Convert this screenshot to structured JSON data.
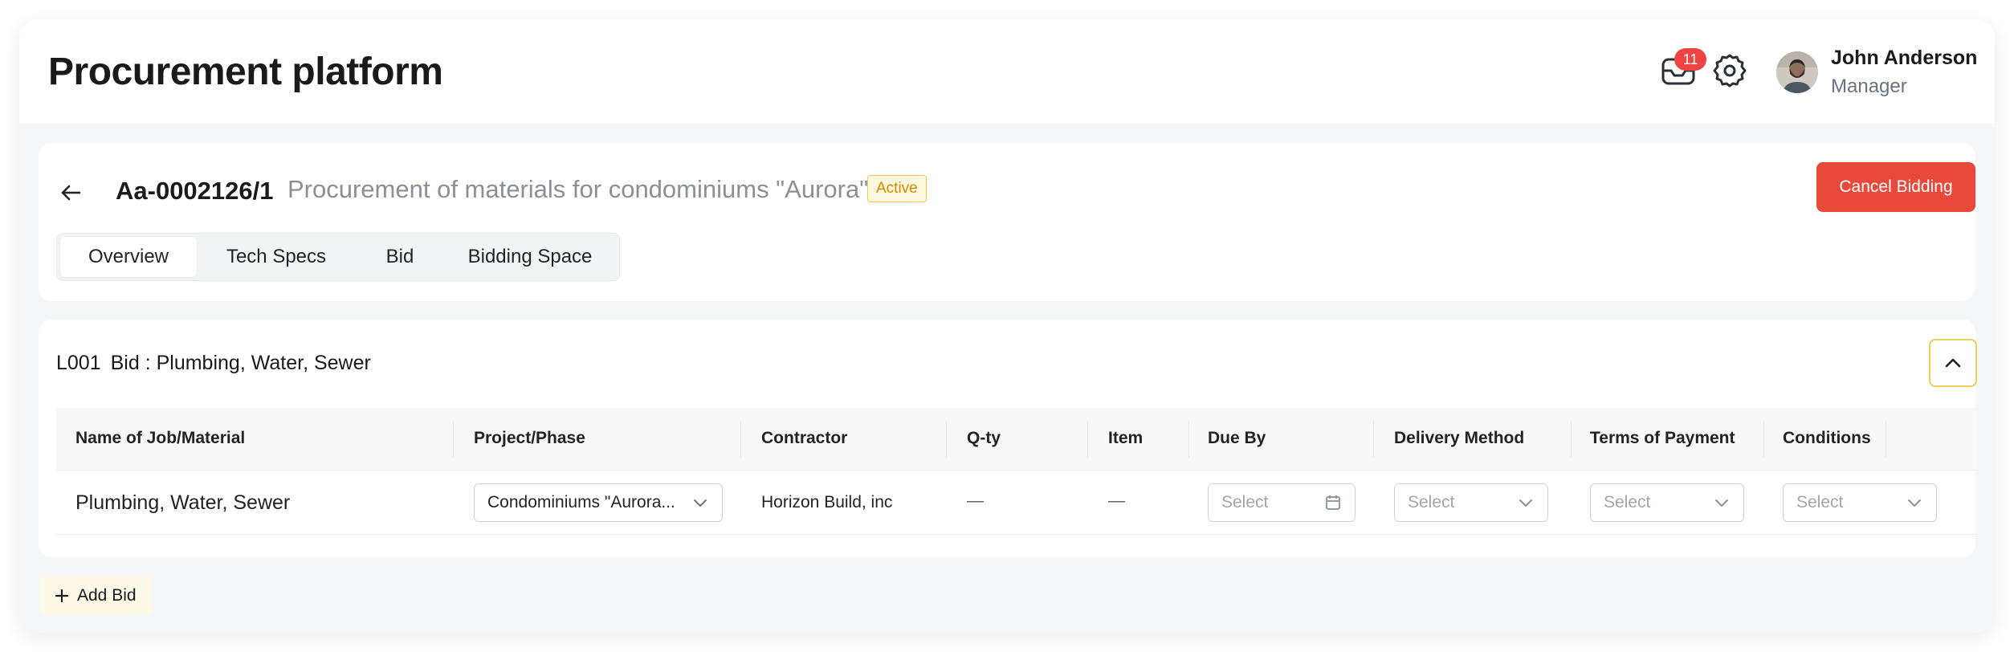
{
  "header": {
    "title": "Procurement platform",
    "notifications_count": "11",
    "user": {
      "name": "John Anderson",
      "role": "Manager"
    }
  },
  "bid": {
    "id": "Aa-0002126/1",
    "description": "Procurement of materials for condominiums \"Aurora\"",
    "status": "Active",
    "cancel_label": "Cancel Bidding",
    "tabs": [
      {
        "label": "Overview",
        "active": true
      },
      {
        "label": "Tech Specs",
        "active": false
      },
      {
        "label": "Bid",
        "active": false
      },
      {
        "label": "Bidding Space",
        "active": false
      }
    ]
  },
  "lot": {
    "code": "L001",
    "title": "Bid : Plumbing, Water, Sewer",
    "columns": [
      "Name of Job/Material",
      "Project/Phase",
      "Contractor",
      "Q-ty",
      "Item",
      "Due By",
      "Delivery Method",
      "Terms of Payment",
      "Conditions"
    ],
    "row": {
      "name": "Plumbing, Water, Sewer",
      "project_phase": "Condominiums \"Aurora...",
      "contractor": "Horizon Build, inc",
      "qty": "—",
      "item": "—",
      "due_by_placeholder": "Select",
      "delivery_placeholder": "Select",
      "payment_placeholder": "Select",
      "conditions_placeholder": "Select"
    }
  },
  "add_bid_label": "Add Bid",
  "colors": {
    "danger": "#e9493a",
    "badge": "#ef4444",
    "active_badge_text": "#d08a00",
    "accent_yellow": "#f2d054"
  }
}
